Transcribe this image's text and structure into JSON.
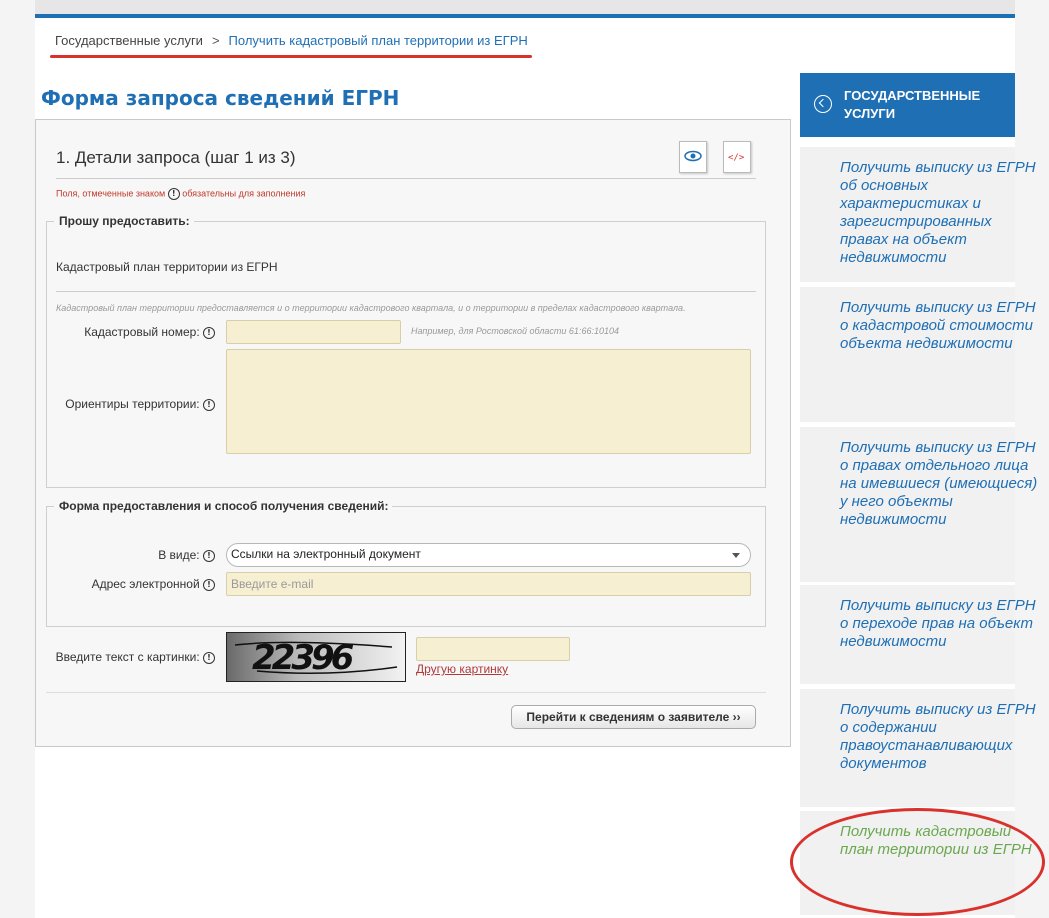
{
  "breadcrumb": {
    "root": "Государственные услуги",
    "sep": ">",
    "current": "Получить кадастровый план территории из ЕГРН"
  },
  "page_title": "Форма запроса сведений ЕГРН",
  "form": {
    "step_title": "1. Детали запроса (шаг 1 из 3)",
    "required_note_before": "Поля, отмеченные знаком",
    "required_note_after": "обязательны для заполнения",
    "info_glyph": "!",
    "section1": {
      "legend": "Прошу предоставить:",
      "service": "Кадастровый план территории из ЕГРН",
      "note": "Кадастровый план территории предоставляется и о территории кадастрового квартала, и о территории в пределах кадастрового квартала.",
      "cadastral_label": "Кадастровый номер:",
      "cadastral_value": "",
      "cadastral_hint": "Например, для Ростовской области 61:66:10104",
      "landmarks_label": "Ориентиры территории:",
      "landmarks_value": ""
    },
    "section2": {
      "legend": "Форма предоставления и способ получения сведений:",
      "format_label": "В виде:",
      "format_value": "Ссылки на электронный документ",
      "email_label": "Адрес электронной",
      "email_placeholder": "Введите e-mail"
    },
    "captcha": {
      "label": "Введите текст с картинки:",
      "image_text": "22396",
      "value": "",
      "other_link": "Другую картинку"
    },
    "next_button": "Перейти к сведениям о заявителе ››"
  },
  "sidebar": {
    "header": "ГОСУДАРСТВЕННЫЕ УСЛУГИ",
    "items": [
      {
        "label": "Получить выписку из ЕГРН об основных характеристиках и зарегистрированных правах на объект недвижимости"
      },
      {
        "label": "Получить выписку из ЕГРН о кадастровой стоимости объекта недвижимости"
      },
      {
        "label": "Получить выписку из ЕГРН о правах отдельного лица на имевшиеся (имеющиеся) у него объекты недвижимости"
      },
      {
        "label": "Получить выписку из ЕГРН о переходе прав на объект недвижимости"
      },
      {
        "label": "Получить выписку из ЕГРН о содержании правоустанавливающих документов"
      },
      {
        "label": "Получить кадастровый план территории из ЕГРН"
      }
    ]
  },
  "colors": {
    "brand_blue": "#1f6fb4",
    "active_green": "#6aa84f",
    "highlight_red": "#d9312b",
    "input_bg": "#f7efd2"
  }
}
